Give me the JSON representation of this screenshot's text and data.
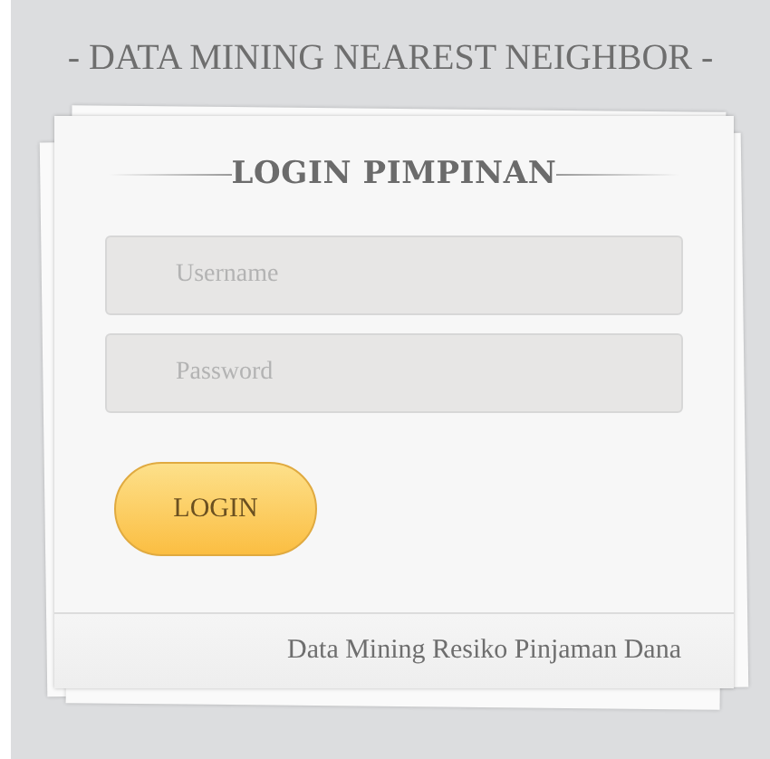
{
  "header": {
    "title": "- DATA MINING NEAREST NEIGHBOR -"
  },
  "login": {
    "heading": "LOGIN PIMPINAN",
    "fields": [
      {
        "placeholder": "Username"
      },
      {
        "placeholder": "Password"
      }
    ],
    "button": "LOGIN",
    "footer": "Data Mining Resiko Pinjaman Dana"
  }
}
